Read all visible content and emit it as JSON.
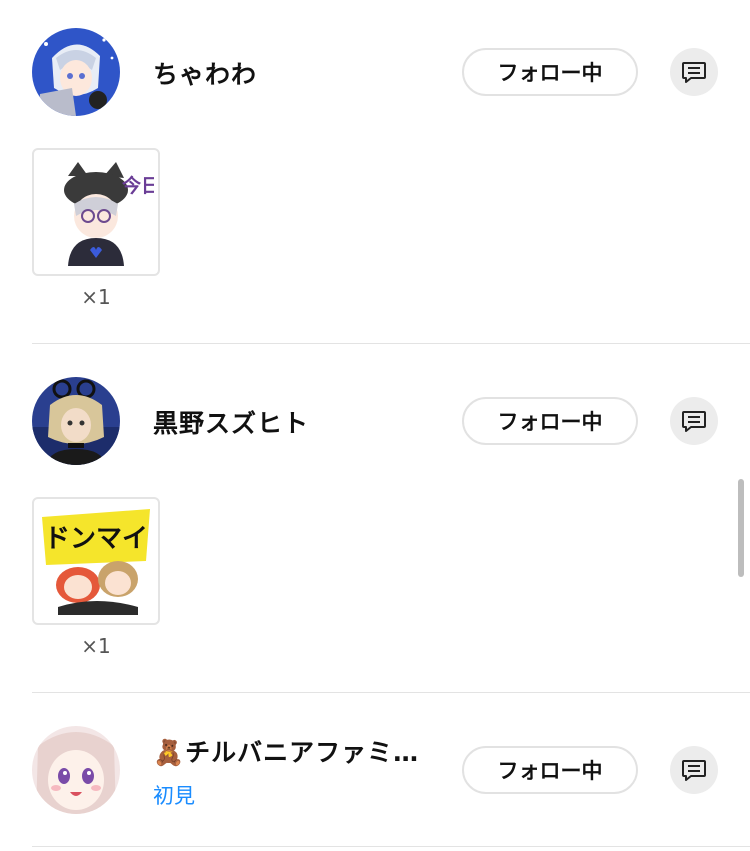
{
  "users": [
    {
      "name": "ちゃわわ",
      "follow_label": "フォロー中",
      "message_icon": "message-icon",
      "sticker": {
        "count_label": "×1",
        "text": "今日、ひま?"
      }
    },
    {
      "name": "黒野スズヒト",
      "follow_label": "フォロー中",
      "message_icon": "message-icon",
      "sticker": {
        "count_label": "×1",
        "text": "ドンマイ"
      }
    },
    {
      "name": "🧸チルバニアファミ…",
      "subtitle": "初見",
      "follow_label": "フォロー中",
      "message_icon": "message-icon"
    }
  ],
  "colors": {
    "link": "#1a8cff",
    "button_border": "#e2e2e2",
    "message_bg": "#ececec"
  }
}
